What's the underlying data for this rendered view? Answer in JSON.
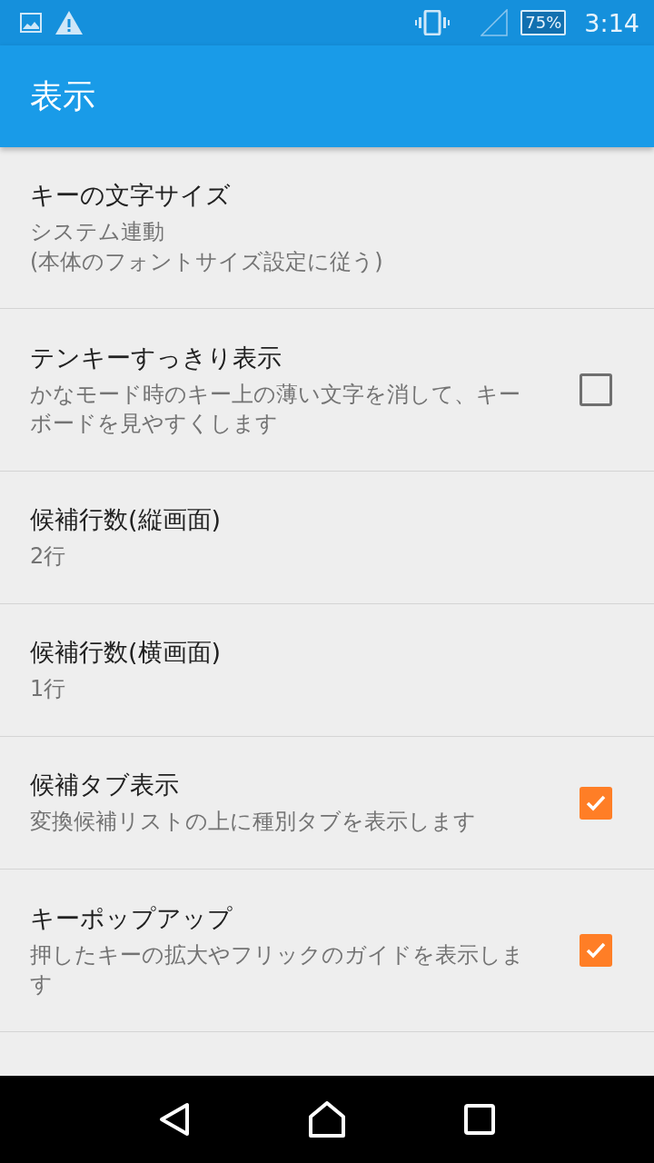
{
  "status_bar": {
    "battery": "75%",
    "time": "3:14"
  },
  "app_bar": {
    "title": "表示"
  },
  "settings": [
    {
      "kind": "text",
      "title": "キーの文字サイズ",
      "summary": "システム連動\n(本体のフォントサイズ設定に従う)"
    },
    {
      "kind": "checkbox",
      "title": "テンキーすっきり表示",
      "summary": "かなモード時のキー上の薄い文字を消して、キーボードを見やすくします",
      "checked": false
    },
    {
      "kind": "text",
      "title": "候補行数(縦画面)",
      "summary": "2行"
    },
    {
      "kind": "text",
      "title": "候補行数(横画面)",
      "summary": "1行"
    },
    {
      "kind": "checkbox",
      "title": "候補タブ表示",
      "summary": "変換候補リストの上に種別タブを表示します",
      "checked": true
    },
    {
      "kind": "checkbox",
      "title": "キーポップアップ",
      "summary": "押したキーの拡大やフリックのガイドを表示します",
      "checked": true
    }
  ]
}
